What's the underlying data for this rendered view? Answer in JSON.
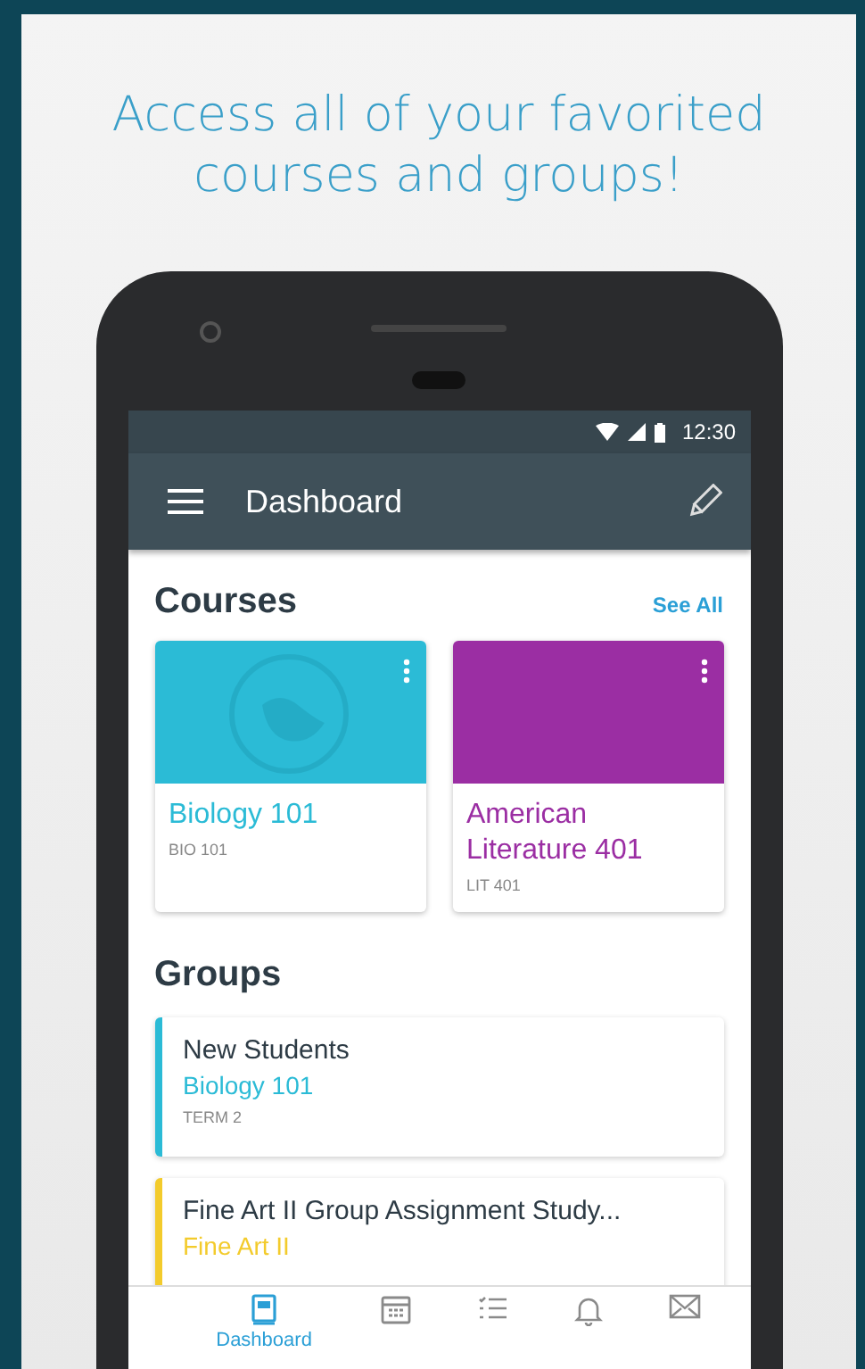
{
  "headline": "Access all of your favorited courses and groups!",
  "status_bar": {
    "time": "12:30"
  },
  "app_bar": {
    "title": "Dashboard"
  },
  "courses": {
    "title": "Courses",
    "link": "See All",
    "items": [
      {
        "name": "Biology 101",
        "code": "BIO 101",
        "color": "#2bbbd6",
        "image": true
      },
      {
        "name": "American Literature 401",
        "code": "LIT 401",
        "color": "#9b2ea3",
        "image": false
      }
    ]
  },
  "groups": {
    "title": "Groups",
    "items": [
      {
        "name": "New Students",
        "course": "Biology 101",
        "term": "TERM 2",
        "color": "#2bbbd6"
      },
      {
        "name": "Fine Art II Group Assignment Study...",
        "course": "Fine Art II",
        "color": "#f3cb2c"
      }
    ]
  },
  "bottom_nav": [
    {
      "kind": "dashboard",
      "label": "Dashboard",
      "selected": true
    },
    {
      "kind": "calendar",
      "selected": false
    },
    {
      "kind": "todo",
      "selected": false
    },
    {
      "kind": "notifications",
      "selected": false
    },
    {
      "kind": "inbox",
      "selected": false
    }
  ]
}
